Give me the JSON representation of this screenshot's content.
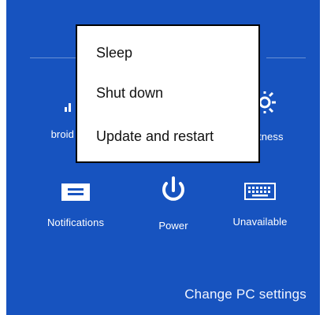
{
  "settings_panel": {
    "tiles_row1": [
      {
        "label": "broid",
        "icon": "network-signal-icon"
      },
      {
        "label": "tness",
        "icon": "brightness-icon"
      }
    ],
    "tiles_row2": [
      {
        "label": "Notifications",
        "icon": "notifications-icon"
      },
      {
        "label": "Power",
        "icon": "power-icon"
      },
      {
        "label": "Unavailable",
        "icon": "keyboard-icon"
      }
    ],
    "change_pc_settings": "Change PC settings"
  },
  "power_menu": {
    "items": [
      "Sleep",
      "Shut down",
      "Update and restart"
    ]
  },
  "colors": {
    "panel_background": "#1753bf",
    "menu_background": "#ffffff",
    "menu_border": "#000000"
  }
}
